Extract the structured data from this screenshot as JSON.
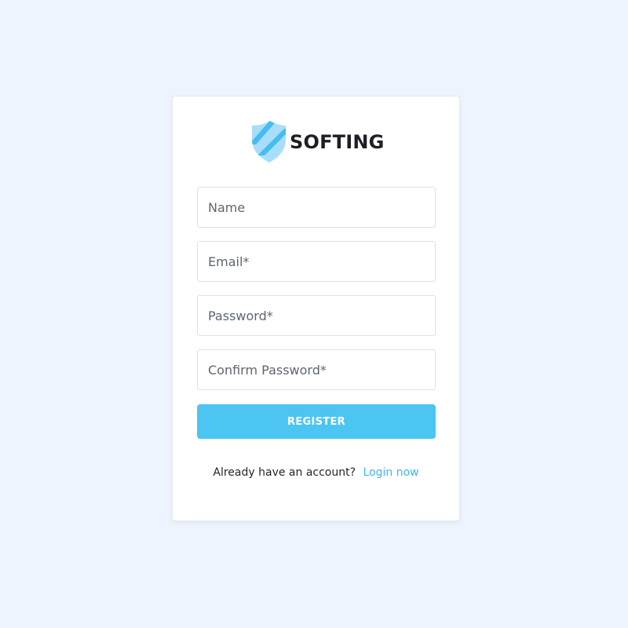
{
  "brand": {
    "name": "SOFTING",
    "colors": {
      "accent": "#4cc5f3",
      "link": "#3fb7ea",
      "background": "#edf4fe",
      "logo_light": "#a9defa",
      "logo_dark": "#45bdf1"
    }
  },
  "form": {
    "name_placeholder": "Name",
    "email_placeholder": "Email*",
    "password_placeholder": "Password*",
    "confirm_password_placeholder": "Confirm Password*",
    "submit_label": "REGISTER"
  },
  "footer": {
    "prompt": "Already have an account?",
    "login_link": "Login now"
  },
  "icons": {
    "logo": "shield-icon"
  }
}
